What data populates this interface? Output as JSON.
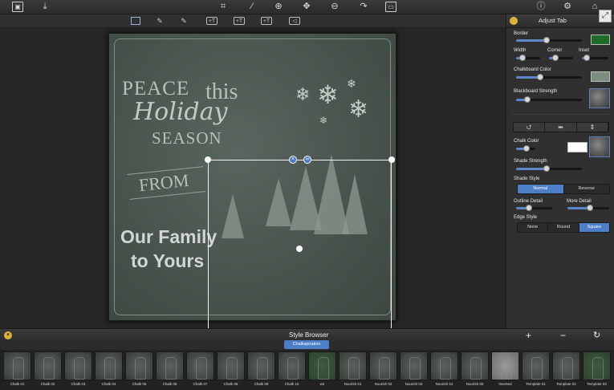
{
  "top_toolbar": {
    "icons": [
      "photo-icon",
      "import-icon",
      "crop-icon",
      "brush-icon",
      "zoom-in-icon",
      "move-icon",
      "zoom-out-icon",
      "redo-icon",
      "export-icon",
      "info-icon",
      "gear-icon",
      "share-icon"
    ]
  },
  "sub_toolbar": {
    "icons": [
      "select-rect-icon",
      "pen-tool-icon",
      "pen-tool-2-icon",
      "add-text-icon",
      "add-text-2-icon",
      "add-text-3-icon",
      "tag-icon"
    ]
  },
  "canvas": {
    "text": {
      "peace": "PEACE",
      "this": "this",
      "holiday": "Holiday",
      "season": "SEASON",
      "from": "FROM",
      "our_family": "Our Family",
      "to_yours": "to Yours"
    }
  },
  "panel": {
    "title": "Adjust Tab",
    "border_label": "Border",
    "border_value": 0.45,
    "border_color": "#1f6b28",
    "width_label": "Width",
    "corner_label": "Corner",
    "inset_label": "Inset",
    "chalkboard_color_label": "Chalkboard Color",
    "chalkboard_color": "#7d8e80",
    "blackboard_strength_label": "Blackboard Strength",
    "chalk_color_label": "Chalk Color",
    "chalk_color": "#ffffff",
    "shade_strength_label": "Shade Strength",
    "shade_style_label": "Shade Style",
    "shade_style_options": [
      "Normal",
      "Reverse"
    ],
    "shade_style_selected": "Normal",
    "outline_detail_label": "Outline Detail",
    "more_detail_label": "More Detail",
    "edge_style_label": "Edge Style",
    "edge_style_options": [
      "None",
      "Round",
      "Square"
    ],
    "edge_style_selected": "Square",
    "accent_color": "#4d7fc9"
  },
  "style_browser": {
    "title": "Style Browser",
    "category": "Chalkspiration",
    "add_label": "+",
    "remove_label": "−",
    "thumbnails": [
      "Chalk 01",
      "Chalk 02",
      "Chalk 03",
      "Chalk 04",
      "Chalk 05",
      "Chalk 06",
      "Chalk 07",
      "Chalk 08",
      "Chalk 09",
      "Chalk 10",
      "w2",
      "Nourish 01",
      "Nourish 02",
      "Nourish 03",
      "Nourish 04",
      "Nourish 05",
      "Inverted",
      "Template 01",
      "Template 02",
      "Template 03"
    ]
  }
}
